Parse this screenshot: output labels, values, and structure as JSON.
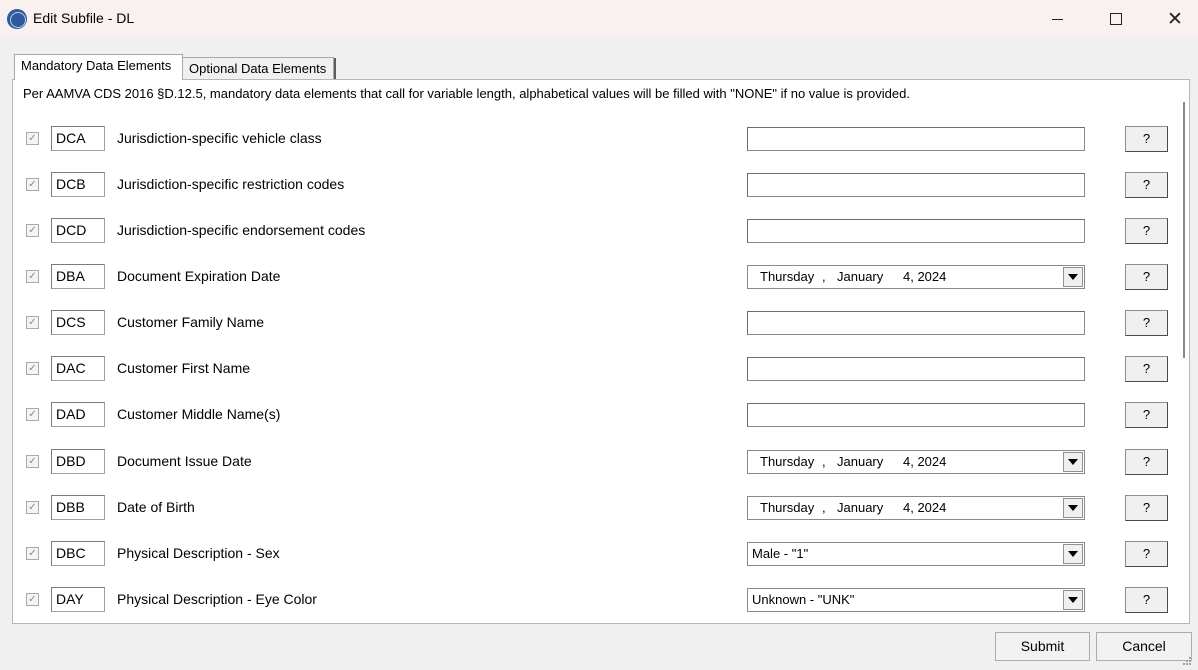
{
  "window": {
    "title": "Edit Subfile - DL",
    "icon": "app-logo-icon",
    "controls": [
      "minimize-icon",
      "maximize-icon",
      "close-icon"
    ],
    "close_glyph": "✕"
  },
  "tabs": [
    {
      "label": "Mandatory Data Elements",
      "selected": true
    },
    {
      "label": "Optional Data Elements",
      "selected": false
    }
  ],
  "note": "Per AAMVA CDS 2016 §D.12.5, mandatory data elements that call for variable length, alphabetical values will be filled with \"NONE\" if no value is provided.",
  "rows": [
    {
      "checked": true,
      "code": "DCA",
      "label": "Jurisdiction-specific vehicle class",
      "input_type": "text",
      "value": "",
      "help": "?"
    },
    {
      "checked": true,
      "code": "DCB",
      "label": "Jurisdiction-specific restriction codes",
      "input_type": "text",
      "value": "",
      "help": "?"
    },
    {
      "checked": true,
      "code": "DCD",
      "label": "Jurisdiction-specific endorsement codes",
      "input_type": "text",
      "value": "",
      "help": "?"
    },
    {
      "checked": true,
      "code": "DBA",
      "label": "Document Expiration Date",
      "input_type": "date",
      "weekday": "Thursday",
      "sep": ",",
      "month": "January",
      "day_year": "4, 2024",
      "help": "?"
    },
    {
      "checked": true,
      "code": "DCS",
      "label": "Customer Family Name",
      "input_type": "text",
      "value": "",
      "help": "?"
    },
    {
      "checked": true,
      "code": "DAC",
      "label": "Customer First Name",
      "input_type": "text",
      "value": "",
      "help": "?"
    },
    {
      "checked": true,
      "code": "DAD",
      "label": "Customer Middle Name(s)",
      "input_type": "text",
      "value": "",
      "help": "?"
    },
    {
      "checked": true,
      "code": "DBD",
      "label": "Document Issue Date",
      "input_type": "date",
      "weekday": "Thursday",
      "sep": ",",
      "month": "January",
      "day_year": "4, 2024",
      "help": "?"
    },
    {
      "checked": true,
      "code": "DBB",
      "label": "Date of Birth",
      "input_type": "date",
      "weekday": "Thursday",
      "sep": ",",
      "month": "January",
      "day_year": "4, 2024",
      "help": "?"
    },
    {
      "checked": true,
      "code": "DBC",
      "label": "Physical Description - Sex",
      "input_type": "select",
      "value": "Male - \"1\"",
      "help": "?"
    },
    {
      "checked": true,
      "code": "DAY",
      "label": "Physical Description - Eye Color",
      "input_type": "select",
      "value": "Unknown - \"UNK\"",
      "help": "?"
    }
  ],
  "check_glyph": "✓",
  "buttons": {
    "submit": "Submit",
    "cancel": "Cancel"
  }
}
